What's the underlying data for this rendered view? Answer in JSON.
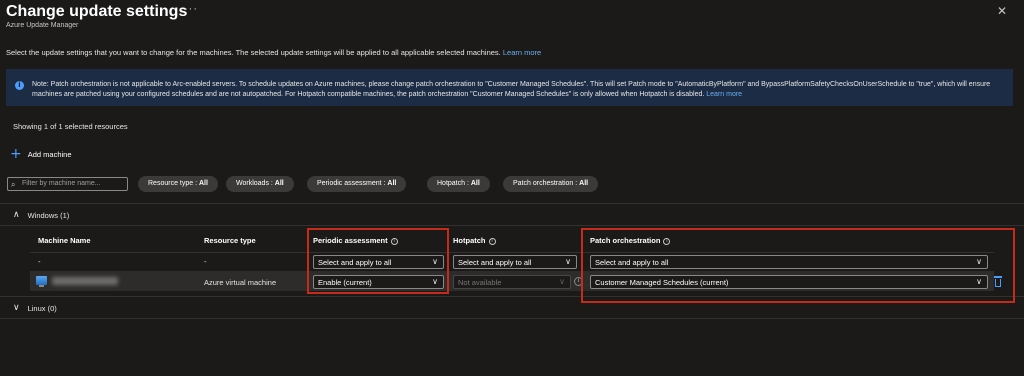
{
  "header": {
    "title": "Change update settings",
    "more": "···",
    "subtitle": "Azure Update Manager",
    "close": "✕"
  },
  "intro": {
    "text": "Select the update settings that you want to change for the machines. The selected update settings will be applied to all applicable selected machines.",
    "link": "Learn more"
  },
  "info": {
    "icon": "i",
    "text": "Note: Patch orchestration is not applicable to Arc-enabled servers. To schedule updates on Azure machines, please change patch orchestration to \"Customer Managed Schedules\". This will set Patch mode to \"AutomaticByPlatform\" and BypassPlatformSafetyChecksOnUserSchedule to \"true\", which will ensure machines are patched using your configured schedules and are not autopatched. For Hotpatch compatible machines, the patch orchestration \"Customer Managed Schedules\" is only allowed when Hotpatch is disabled.",
    "link": "Learn more"
  },
  "showing": "Showing 1 of 1 selected resources",
  "add_machine": {
    "icon": "+",
    "label": "Add machine"
  },
  "filters": {
    "search_placeholder": "Filter by machine name...",
    "pills": [
      {
        "label": "Resource type : ",
        "value": "All"
      },
      {
        "label": "Workloads : ",
        "value": "All"
      },
      {
        "label": "Periodic assessment : ",
        "value": "All"
      },
      {
        "label": "Hotpatch : ",
        "value": "All"
      },
      {
        "label": "Patch orchestration : ",
        "value": "All"
      }
    ]
  },
  "groups": {
    "windows": {
      "chevron": "∧",
      "label": "Windows (1)"
    },
    "linux": {
      "chevron": "∨",
      "label": "Linux (0)"
    }
  },
  "table": {
    "columns": {
      "machine_name": "Machine Name",
      "resource_type": "Resource type",
      "periodic_assessment": "Periodic assessment",
      "hotpatch": "Hotpatch",
      "patch_orchestration": "Patch orchestration",
      "info_icon": "i"
    },
    "apply_row": {
      "machine_name": "-",
      "resource_type": "-",
      "periodic_assessment": "Select and apply to all",
      "hotpatch": "Select and apply to all",
      "patch_orchestration": "Select and apply to all"
    },
    "rows": [
      {
        "resource_type": "Azure virtual machine",
        "periodic_assessment": "Enable (current)",
        "hotpatch": "Not available",
        "patch_orchestration": "Customer Managed Schedules (current)"
      }
    ],
    "dropdown_arrow": "∨",
    "round_info": "i"
  },
  "colors": {
    "background": "#1b1a19",
    "accent": "#4a9eff",
    "info_bg": "#1c2c44",
    "highlight_box": "#c42b1c"
  }
}
